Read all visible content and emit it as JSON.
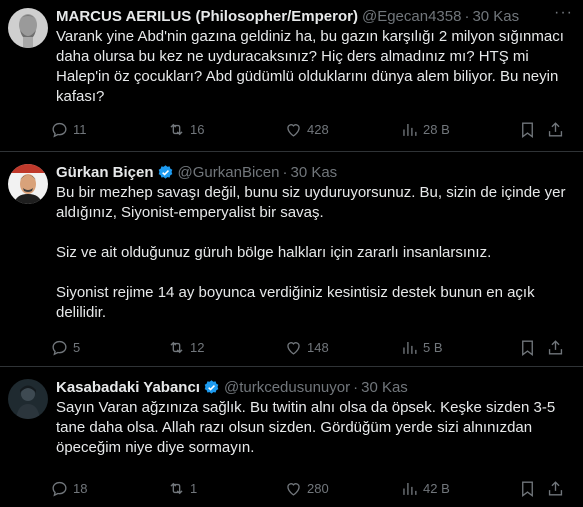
{
  "tweets": [
    {
      "name": "MARCUS AERILUS (Philosopher/Emperor)",
      "handle": "@Egecan4358",
      "time": "30 Kas",
      "verified": false,
      "text": "Varank yine Abd'nin gazına geldiniz ha, bu gazın karşılığı 2 milyon sığınmacı\ndaha olursa bu kez ne uyduracaksınız? Hiç ders almadınız mı? HTŞ mi\nHalep'in öz çocukları? Abd güdümlü olduklarını dünya alem biliyor. Bu neyin\nkafası?",
      "replies": "11",
      "retweets": "16",
      "likes": "428",
      "views": "28 B"
    },
    {
      "name": "Gürkan Biçen",
      "handle": "@GurkanBicen",
      "time": "30 Kas",
      "verified": true,
      "text": "Bu bir mezhep savaşı değil, bunu siz uyduruyorsunuz. Bu, sizin de içinde yer\naldığınız, Siyonist-emperyalist bir savaş.\n\nSiz ve ait olduğunuz güruh bölge halkları için zararlı insanlarsınız.\n\nSiyonist rejime 14 ay boyunca verdiğiniz kesintisiz destek bunun en açık\ndelilidir.",
      "replies": "5",
      "retweets": "12",
      "likes": "148",
      "views": "5 B"
    },
    {
      "name": "Kasabadaki Yabancı",
      "handle": "@turkcedusunuyor",
      "time": "30 Kas",
      "verified": true,
      "text": "Sayın Varan ağzınıza sağlık. Bu twitin alnı olsa da öpsek. Keşke sizden 3-5\ntane daha olsa. Allah razı olsun sizden. Gördüğüm yerde sizi alnınızdan\nöpeceğim niye diye sormayın.",
      "replies": "18",
      "retweets": "1",
      "likes": "280",
      "views": "42 B"
    }
  ],
  "dot": "·",
  "more": "···",
  "colors": {
    "background": "#000000",
    "text": "#e7e9ea",
    "muted": "#71767b",
    "verified": "#1d9bf0",
    "divider": "#2f3336"
  },
  "icons": [
    "reply-icon",
    "retweet-icon",
    "like-icon",
    "views-icon",
    "bookmark-icon",
    "share-icon",
    "more-icon",
    "verified-badge-icon"
  ]
}
